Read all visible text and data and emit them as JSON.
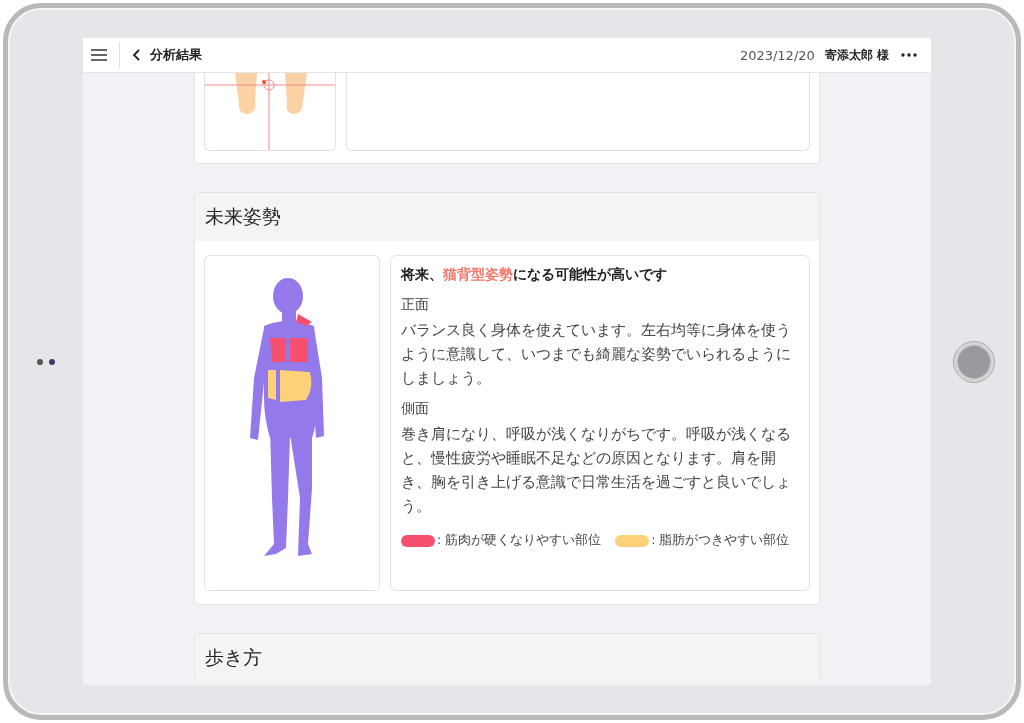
{
  "header": {
    "title": "分析結果",
    "date": "2023/12/20",
    "user": "寄添太郎 様"
  },
  "future_posture": {
    "heading": "未来姿勢",
    "summary": [
      {
        "text": "将来、",
        "highlight": false
      },
      {
        "text": "猫背型姿勢",
        "highlight": true
      },
      {
        "text": "になる可能性が高いです",
        "highlight": false
      }
    ],
    "views": [
      {
        "label": "正面",
        "text": "バランス良く身体を使えています。左右均等に身体を使うように意識して、いつまでも綺麗な姿勢でいられるようにしましょう。"
      },
      {
        "label": "側面",
        "text": "巻き肩になり、呼吸が浅くなりがちです。呼吸が浅くなると、慢性疲労や睡眠不足などの原因となります。肩を開き、胸を引き上げる意識で日常生活を過ごすと良いでしょう。"
      }
    ],
    "legend": [
      {
        "color": "#f7506e",
        "label": ": 筋肉が硬くなりやすい部位"
      },
      {
        "color": "#fdd07a",
        "label": ": 脂肪がつきやすい部位"
      }
    ]
  },
  "next_section": {
    "heading": "歩き方"
  }
}
